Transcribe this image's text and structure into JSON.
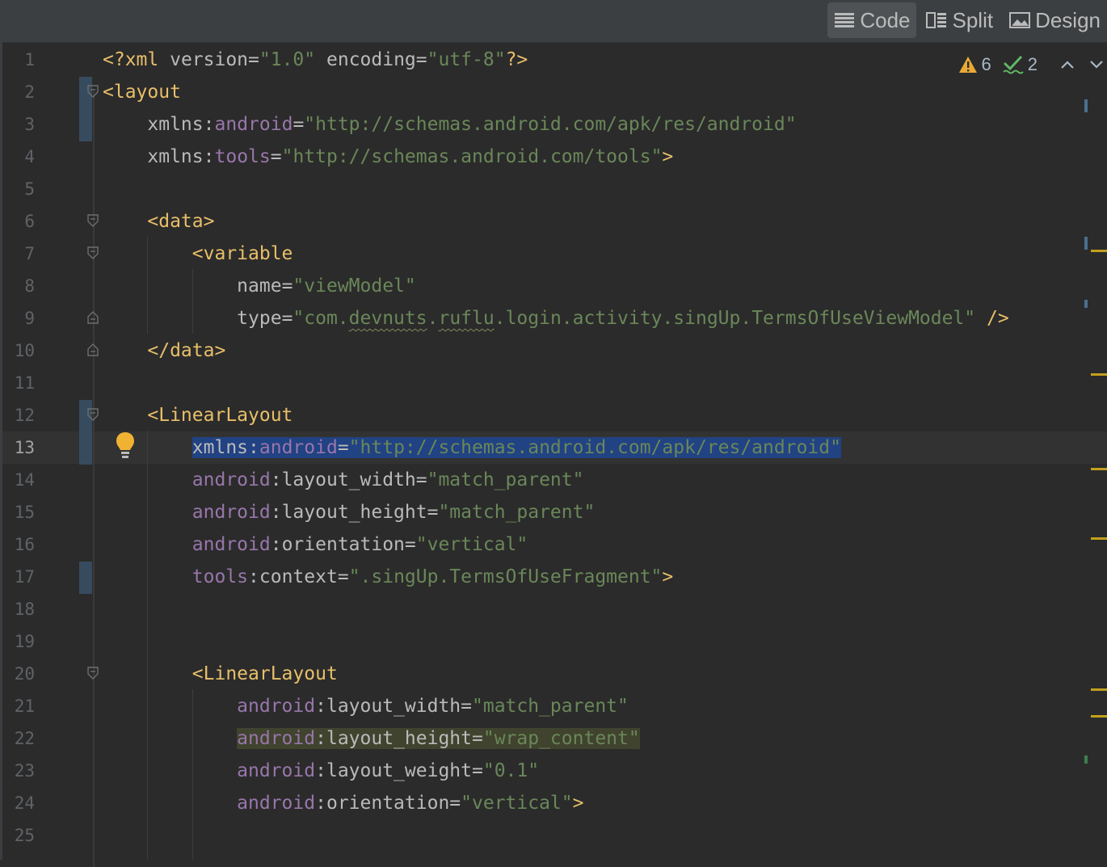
{
  "toolbar": {
    "code_label": "Code",
    "split_label": "Split",
    "design_label": "Design",
    "active": "code"
  },
  "inspections": {
    "warnings_count": "6",
    "weak_warnings_count": "2"
  },
  "colors": {
    "background": "#2b2b2b",
    "tag": "#e8bf6a",
    "namespace": "#9876aa",
    "string": "#6a8759",
    "selection": "#214283",
    "warning": "#c4a01b"
  },
  "editor": {
    "current_line": 13,
    "lines": [
      {
        "num": "1",
        "tokens": [
          [
            "tag",
            "<?"
          ],
          [
            "tag",
            "xml "
          ],
          [
            "attr",
            "version"
          ],
          [
            "eq",
            "="
          ],
          [
            "str",
            "\"1.0\""
          ],
          [
            "plain",
            " "
          ],
          [
            "attr",
            "encoding"
          ],
          [
            "eq",
            "="
          ],
          [
            "str",
            "\"utf-8\""
          ],
          [
            "tag",
            "?>"
          ]
        ]
      },
      {
        "num": "2",
        "tokens": [
          [
            "tag",
            "<layout"
          ]
        ]
      },
      {
        "num": "3",
        "tokens": [
          [
            "plain",
            "    "
          ],
          [
            "attr",
            "xmlns"
          ],
          [
            "eq",
            ":"
          ],
          [
            "ns",
            "android"
          ],
          [
            "eq",
            "="
          ],
          [
            "str",
            "\"http://schemas.android.com/apk/res/android\""
          ]
        ]
      },
      {
        "num": "4",
        "tokens": [
          [
            "plain",
            "    "
          ],
          [
            "attr",
            "xmlns"
          ],
          [
            "eq",
            ":"
          ],
          [
            "ns",
            "tools"
          ],
          [
            "eq",
            "="
          ],
          [
            "str",
            "\"http://schemas.android.com/tools\""
          ],
          [
            "tag",
            ">"
          ]
        ]
      },
      {
        "num": "5",
        "tokens": []
      },
      {
        "num": "6",
        "tokens": [
          [
            "plain",
            "    "
          ],
          [
            "tag",
            "<data>"
          ]
        ]
      },
      {
        "num": "7",
        "tokens": [
          [
            "plain",
            "        "
          ],
          [
            "tag",
            "<variable"
          ]
        ]
      },
      {
        "num": "8",
        "tokens": [
          [
            "plain",
            "            "
          ],
          [
            "attr",
            "name"
          ],
          [
            "eq",
            "="
          ],
          [
            "str",
            "\"viewModel\""
          ]
        ]
      },
      {
        "num": "9",
        "tokens": [
          [
            "plain",
            "            "
          ],
          [
            "attr",
            "type"
          ],
          [
            "eq",
            "="
          ],
          [
            "str",
            "\"com."
          ],
          [
            "sq",
            "devnuts"
          ],
          [
            "str",
            "."
          ],
          [
            "sq",
            "ruflu"
          ],
          [
            "str",
            ".login.activity.singUp.TermsOfUseViewModel\""
          ],
          [
            "plain",
            " "
          ],
          [
            "tag",
            "/>"
          ]
        ]
      },
      {
        "num": "10",
        "tokens": [
          [
            "plain",
            "    "
          ],
          [
            "tag",
            "</data>"
          ]
        ]
      },
      {
        "num": "11",
        "tokens": []
      },
      {
        "num": "12",
        "tokens": [
          [
            "plain",
            "    "
          ],
          [
            "tag",
            "<LinearLayout"
          ]
        ]
      },
      {
        "num": "13",
        "tokens": [
          [
            "plain",
            "        "
          ],
          [
            "sel-attr",
            "xmlns"
          ],
          [
            "sel-eq",
            ":"
          ],
          [
            "sel-ns",
            "android"
          ],
          [
            "sel-eq",
            "="
          ],
          [
            "sel-str",
            "\"http://schemas.android.com/apk/res/android\""
          ]
        ]
      },
      {
        "num": "14",
        "tokens": [
          [
            "plain",
            "        "
          ],
          [
            "ns",
            "android"
          ],
          [
            "eq",
            ":"
          ],
          [
            "attr",
            "layout_width"
          ],
          [
            "eq",
            "="
          ],
          [
            "str",
            "\"match_parent\""
          ]
        ]
      },
      {
        "num": "15",
        "tokens": [
          [
            "plain",
            "        "
          ],
          [
            "ns",
            "android"
          ],
          [
            "eq",
            ":"
          ],
          [
            "attr",
            "layout_height"
          ],
          [
            "eq",
            "="
          ],
          [
            "str",
            "\"match_parent\""
          ]
        ]
      },
      {
        "num": "16",
        "tokens": [
          [
            "plain",
            "        "
          ],
          [
            "ns",
            "android"
          ],
          [
            "eq",
            ":"
          ],
          [
            "attr",
            "orientation"
          ],
          [
            "eq",
            "="
          ],
          [
            "str",
            "\"vertical\""
          ]
        ]
      },
      {
        "num": "17",
        "tokens": [
          [
            "plain",
            "        "
          ],
          [
            "ns",
            "tools"
          ],
          [
            "eq",
            ":"
          ],
          [
            "attr",
            "context"
          ],
          [
            "eq",
            "="
          ],
          [
            "str",
            "\".singUp.TermsOfUseFragment\""
          ],
          [
            "tag",
            ">"
          ]
        ]
      },
      {
        "num": "18",
        "tokens": []
      },
      {
        "num": "19",
        "tokens": []
      },
      {
        "num": "20",
        "tokens": [
          [
            "plain",
            "        "
          ],
          [
            "tag",
            "<LinearLayout"
          ]
        ]
      },
      {
        "num": "21",
        "tokens": [
          [
            "plain",
            "            "
          ],
          [
            "ns",
            "android"
          ],
          [
            "eq",
            ":"
          ],
          [
            "attr",
            "layout_width"
          ],
          [
            "eq",
            "="
          ],
          [
            "str",
            "\"match_parent\""
          ]
        ]
      },
      {
        "num": "22",
        "tokens": [
          [
            "plain",
            "            "
          ],
          [
            "hl-ns",
            "android"
          ],
          [
            "hl-eq",
            ":"
          ],
          [
            "hl-attr",
            "layout_height"
          ],
          [
            "hl-eq",
            "="
          ],
          [
            "hl-str",
            "\"wrap_content\""
          ]
        ]
      },
      {
        "num": "23",
        "tokens": [
          [
            "plain",
            "            "
          ],
          [
            "ns",
            "android"
          ],
          [
            "eq",
            ":"
          ],
          [
            "attr",
            "layout_weight"
          ],
          [
            "eq",
            "="
          ],
          [
            "str",
            "\"0.1\""
          ]
        ]
      },
      {
        "num": "24",
        "tokens": [
          [
            "plain",
            "            "
          ],
          [
            "ns",
            "android"
          ],
          [
            "eq",
            ":"
          ],
          [
            "attr",
            "orientation"
          ],
          [
            "eq",
            "="
          ],
          [
            "str",
            "\"vertical\""
          ],
          [
            "tag",
            ">"
          ]
        ]
      },
      {
        "num": "25",
        "tokens": []
      }
    ]
  }
}
